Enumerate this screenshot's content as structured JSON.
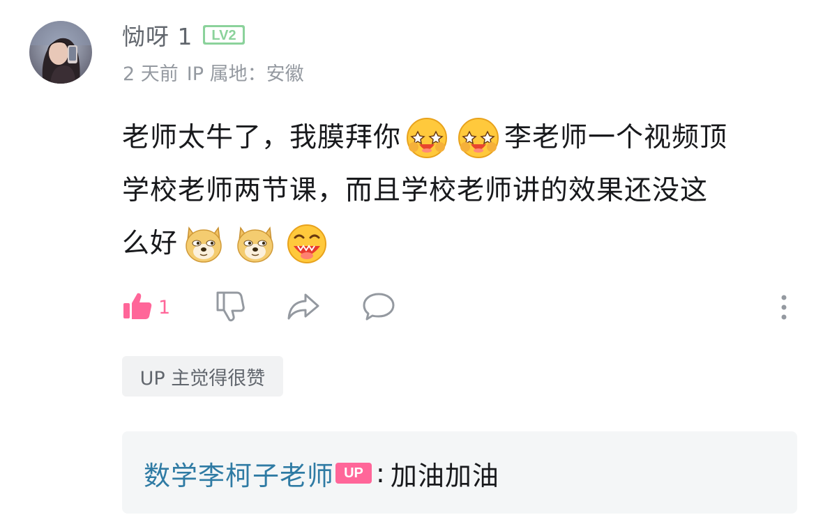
{
  "user": {
    "name": "恸呀 1",
    "level": "LV2",
    "time": "2 天前",
    "ip": "IP 属地：安徽"
  },
  "comment": {
    "line1_a": "老师太牛了，我膜拜你",
    "line1_b": "李老师一个视频顶",
    "line2": "学校老师两节课，而且学校老师讲的效果还没这",
    "line3": "么好"
  },
  "actions": {
    "like_count": "1",
    "like_color": "#ff6699"
  },
  "up_tag": "UP 主觉得很赞",
  "reply": {
    "author": "数学李柯子老师",
    "badge": "UP",
    "colon": ":",
    "text": "加油加油"
  },
  "icons": [
    "thumb-up-icon",
    "thumb-down-icon",
    "share-icon",
    "comment-icon",
    "more-icon",
    "star-eyes-emoji",
    "doge-emoji",
    "drooling-emoji"
  ]
}
